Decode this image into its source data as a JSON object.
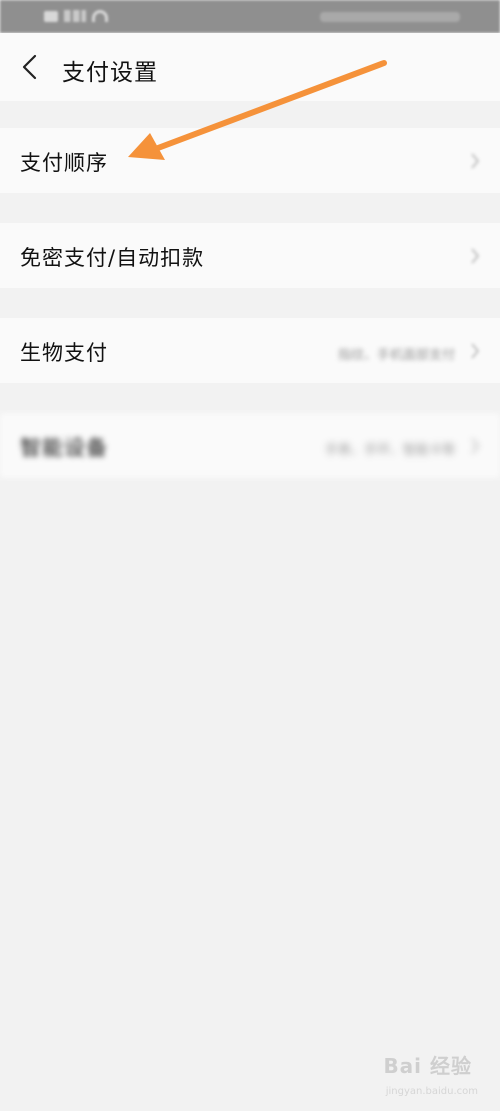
{
  "status_bar": {
    "left_text": "HD 4G",
    "right_text": ""
  },
  "header": {
    "title": "支付设置"
  },
  "rows": [
    {
      "label": "支付顺序",
      "value": ""
    },
    {
      "label": "免密支付/自动扣款",
      "value": ""
    },
    {
      "label": "生物支付",
      "value": "指纹、手机面部支付"
    },
    {
      "label": "智能设备",
      "value": "手表、手环、智能卡等"
    }
  ],
  "annotation": {
    "arrow_color": "#f5923a"
  },
  "watermark": {
    "text": "Bai 经验",
    "url": "jingyan.baidu.com"
  }
}
